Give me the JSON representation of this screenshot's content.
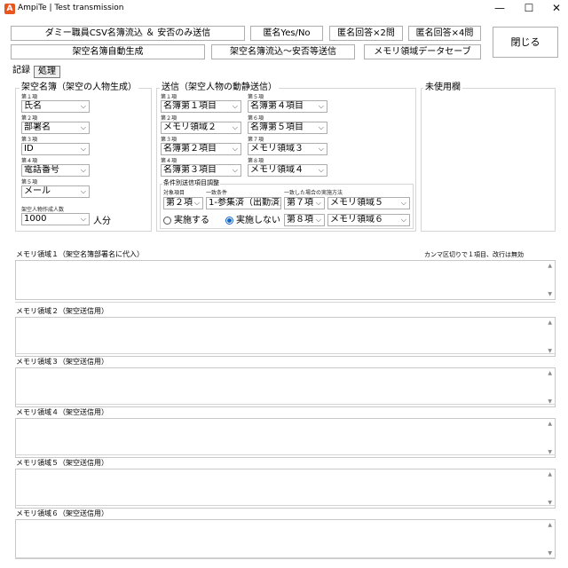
{
  "window": {
    "title": "AmpiTe | Test transmission",
    "icon": "app-icon",
    "controls": {
      "minimize": "—",
      "maximize": "☐",
      "close": "✕"
    }
  },
  "toolbar": {
    "row1": [
      "ダミー職員CSV名簿流込 ＆ 安否のみ送信",
      "匿名Yes/No",
      "匿名回答×2問",
      "匿名回答×4問"
    ],
    "row2": [
      "架空名簿自動生成",
      "架空名簿流込～安否等送信",
      "メモリ領域データセーブ"
    ],
    "close": "閉じる"
  },
  "tabs": [
    "記録",
    "処理"
  ],
  "left_group": {
    "title": "架空名簿（架空の人物生成）",
    "items": [
      {
        "label": "第１項",
        "value": "氏名"
      },
      {
        "label": "第２項",
        "value": "部署名"
      },
      {
        "label": "第３項",
        "value": "ID"
      },
      {
        "label": "第４項",
        "value": "電話番号"
      },
      {
        "label": "第５項",
        "value": "メール"
      }
    ],
    "count_label": "架空人物作成人数",
    "count_value": "1000",
    "count_unit": "人分"
  },
  "mid_group": {
    "title": "送信（架空人物の動静送信）",
    "col1": [
      {
        "label": "第１項",
        "value": "名簿第１項目"
      },
      {
        "label": "第２項",
        "value": "メモリ領域２"
      },
      {
        "label": "第３項",
        "value": "名簿第２項目"
      },
      {
        "label": "第４項",
        "value": "名簿第３項目"
      }
    ],
    "col2": [
      {
        "label": "第５項",
        "value": "名簿第４項目"
      },
      {
        "label": "第６項",
        "value": "名簿第５項目"
      },
      {
        "label": "第７項",
        "value": "メモリ領域３"
      },
      {
        "label": "第８項",
        "value": "メモリ領域４"
      }
    ],
    "cond": {
      "title": "条件別送信項目調整",
      "target_label": "対象項目",
      "match_label": "一致条件",
      "action_label": "一致した場合の実施方法",
      "target_value": "第２項",
      "match_value": "1-参集済（出勤済）",
      "row1_item": "第７項",
      "row1_mem": "メモリ領域５",
      "row2_item": "第８項",
      "row2_mem": "メモリ領域６",
      "radio_do": "実施する",
      "radio_dont": "実施しない"
    }
  },
  "right_group": {
    "title": "未使用欄"
  },
  "memo_hint": "カンマ区切りで１項目、改行は無効",
  "memos": [
    "メモリ領域１（架空名簿部署名に代入）",
    "メモリ領域２（架空送信用）",
    "メモリ領域３（架空送信用）",
    "メモリ領域４（架空送信用）",
    "メモリ領域５（架空送信用）",
    "メモリ領域６（架空送信用）"
  ]
}
